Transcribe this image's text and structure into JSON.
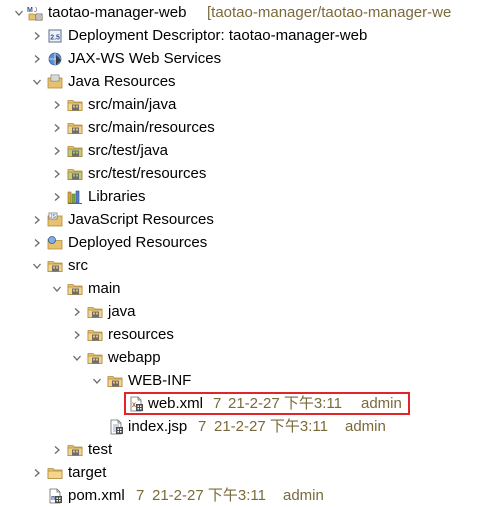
{
  "tree": {
    "project": {
      "name": "taotao-manager-web",
      "path": "[taotao-manager/taotao-manager-we"
    },
    "deployment_descriptor": "Deployment Descriptor: taotao-manager-web",
    "jaxws": "JAX-WS Web Services",
    "java_resources": "Java Resources",
    "src_main_java": "src/main/java",
    "src_main_resources": "src/main/resources",
    "src_test_java": "src/test/java",
    "src_test_resources": "src/test/resources",
    "libraries": "Libraries",
    "javascript_resources": "JavaScript Resources",
    "deployed_resources": "Deployed Resources",
    "src": "src",
    "main": "main",
    "java": "java",
    "resources": "resources",
    "webapp": "webapp",
    "webinf": "WEB-INF",
    "webxml": {
      "name": "web.xml",
      "rev": "7",
      "date": "21-2-27 下午3:11",
      "user": "admin"
    },
    "indexjsp": {
      "name": "index.jsp",
      "rev": "7",
      "date": "21-2-27 下午3:11",
      "user": "admin"
    },
    "test": "test",
    "target": "target",
    "pomxml": {
      "name": "pom.xml",
      "rev": "7",
      "date": "21-2-27 下午3:11",
      "user": "admin"
    }
  },
  "colors": {
    "highlight_border": "#e0262b",
    "decoration_text": "#7a6a3a"
  }
}
